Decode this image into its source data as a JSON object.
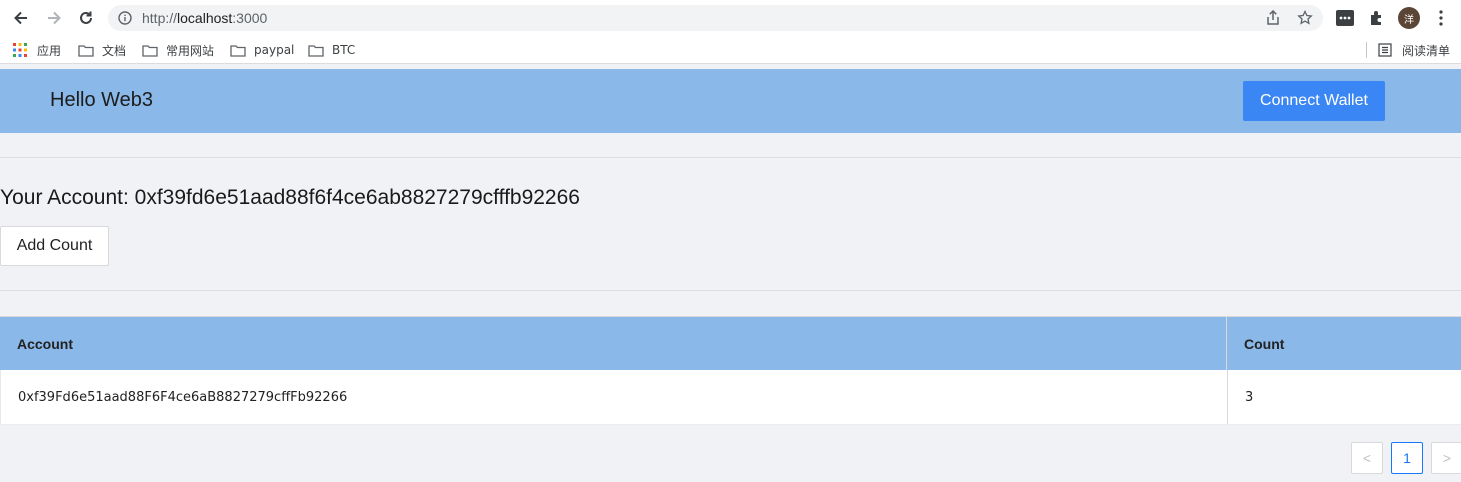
{
  "browser": {
    "url_scheme": "http://",
    "url_host": "localhost",
    "url_port": ":3000",
    "profile_initial": "洋",
    "bookmarks": [
      "应用",
      "文档",
      "常用网站",
      "paypal",
      "BTC"
    ],
    "reading_list": "阅读清单"
  },
  "header": {
    "title": "Hello Web3",
    "connect_label": "Connect Wallet"
  },
  "main": {
    "account_label": "Your Account: ",
    "account_value": "0xf39fd6e51aad88f6f4ce6ab8827279cfffb92266",
    "add_count_label": "Add Count"
  },
  "table": {
    "columns": [
      "Account",
      "Count"
    ],
    "rows": [
      {
        "account": "0xf39Fd6e51aad88F6F4ce6aB8827279cffFb92266",
        "count": "3"
      }
    ]
  },
  "pagination": {
    "prev": "<",
    "page": "1",
    "next": ">"
  },
  "colors": {
    "header_bg": "#8ab8e8",
    "primary": "#3b86f5",
    "page_bg": "#f0f2f5"
  }
}
